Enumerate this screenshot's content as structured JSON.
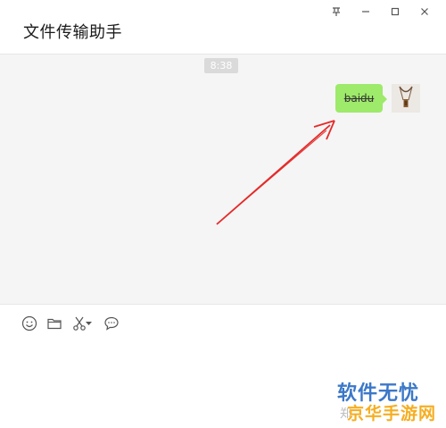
{
  "window": {
    "chat_title": "文件传输助手",
    "controls": [
      "pin-icon",
      "minimize-icon",
      "maximize-icon",
      "close-icon"
    ]
  },
  "chat": {
    "timestamp": "8:38",
    "messages": [
      {
        "text": "baidu",
        "sender": "me",
        "bubble_color": "#9eea6a"
      }
    ]
  },
  "annotation": {
    "arrow_color": "#e52a2a"
  },
  "toolbar": {
    "tools": [
      "emoji-icon",
      "folder-icon",
      "scissors-icon",
      "chat-history-icon"
    ]
  },
  "input": {
    "value": ""
  },
  "watermark": {
    "main": "软件无忧",
    "sub_gray": "郑",
    "sub": "京华手游网"
  }
}
